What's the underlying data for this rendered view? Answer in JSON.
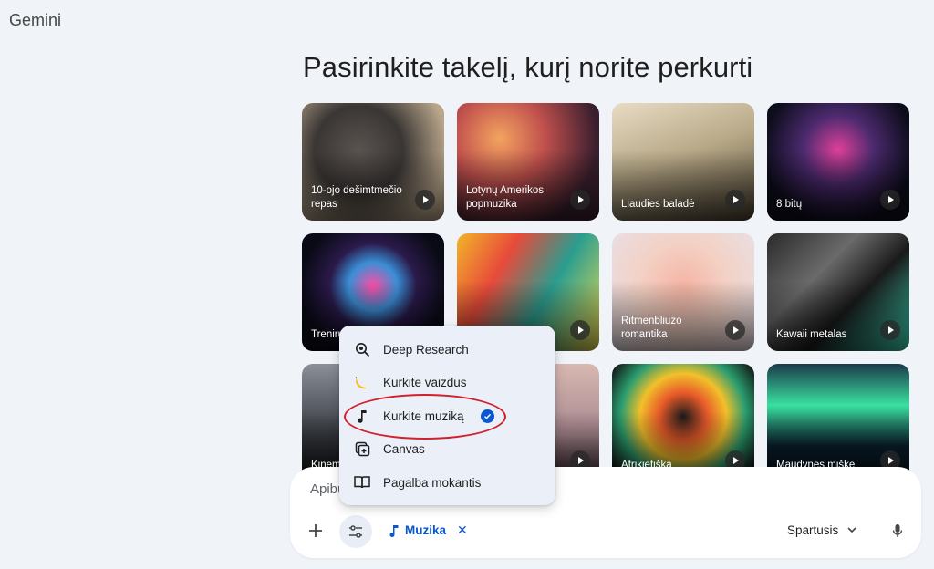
{
  "app": {
    "title": "Gemini"
  },
  "heading": "Pasirinkite takelį, kurį norite perkurti",
  "cards": [
    {
      "label": "10-ojo dešimtmečio repas"
    },
    {
      "label": "Lotynų Amerikos popmuzika"
    },
    {
      "label": "Liaudies baladė"
    },
    {
      "label": "8 bitų"
    },
    {
      "label": "Treniru"
    },
    {
      "label": ""
    },
    {
      "label": "Ritmenbliuzo romantika"
    },
    {
      "label": "Kawaii metalas"
    },
    {
      "label": "Kinem"
    },
    {
      "label": ""
    },
    {
      "label": "Afrikietiška"
    },
    {
      "label": "Maudynės miške"
    }
  ],
  "menu": {
    "items": [
      {
        "label": "Deep Research",
        "icon": "deep-research-icon"
      },
      {
        "label": "Kurkite vaizdus",
        "icon": "banana-icon"
      },
      {
        "label": "Kurkite muziką",
        "icon": "music-note-icon",
        "selected": true
      },
      {
        "label": "Canvas",
        "icon": "canvas-icon"
      },
      {
        "label": "Pagalba mokantis",
        "icon": "book-icon"
      }
    ]
  },
  "input": {
    "placeholder": "Apibu",
    "chip_label": "Muzika",
    "chip_close": "✕",
    "model_label": "Spartusis"
  },
  "colors": {
    "accent": "#0b57d0",
    "highlight_ring": "#d4202a",
    "page_bg": "#f0f4f9"
  }
}
